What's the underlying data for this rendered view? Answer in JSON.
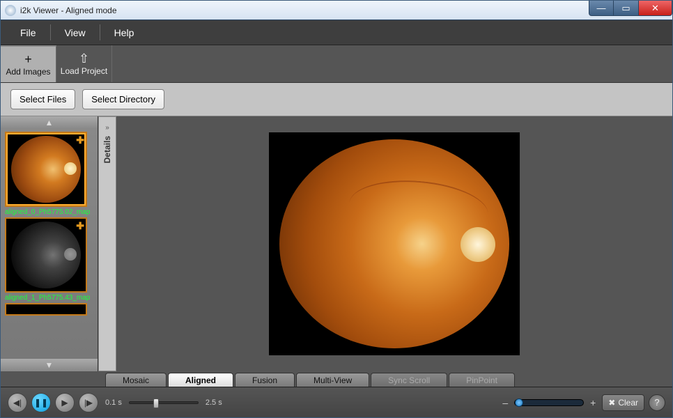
{
  "window": {
    "title": "i2k Viewer - Aligned mode"
  },
  "menu": {
    "file": "File",
    "view": "View",
    "help": "Help"
  },
  "toolbar": {
    "add_images": {
      "label": "Add Images",
      "glyph": "+"
    },
    "load_project": {
      "label": "Load Project",
      "glyph": "⇧"
    }
  },
  "subbar": {
    "select_files": "Select Files",
    "select_directory": "Select Directory"
  },
  "details_tab": {
    "label": "Details",
    "chevron": "»"
  },
  "thumbnails": [
    {
      "label": "aligned_0_Ph5775.02_map",
      "kind": "color"
    },
    {
      "label": "aligned_1_Ph5775.43_map",
      "kind": "gray"
    }
  ],
  "tabs": [
    {
      "label": "Mosaic",
      "state": "inactive"
    },
    {
      "label": "Aligned",
      "state": "active"
    },
    {
      "label": "Fusion",
      "state": "inactive"
    },
    {
      "label": "Multi-View",
      "state": "inactive"
    },
    {
      "label": "Sync Scroll",
      "state": "disabled"
    },
    {
      "label": "PinPoint",
      "state": "disabled"
    }
  ],
  "footer": {
    "time_min": "0.1 s",
    "time_max": "2.5 s",
    "time_slider_pct": 35,
    "zoom_minus": "–",
    "zoom_plus": "+",
    "zoom_slider_pct": 0,
    "clear_label": "Clear",
    "help_glyph": "?"
  }
}
